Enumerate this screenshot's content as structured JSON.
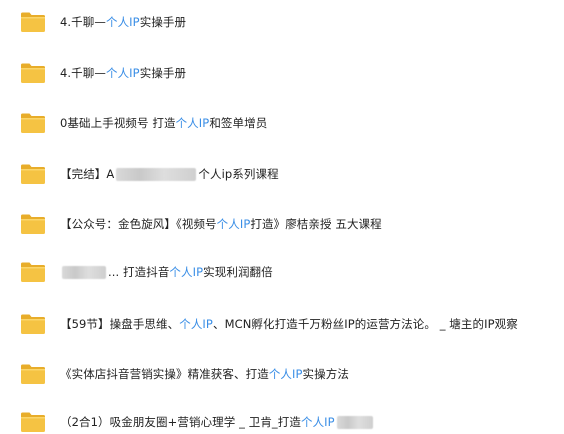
{
  "items": [
    {
      "parts": [
        {
          "t": "4.千聊—",
          "h": false
        },
        {
          "t": "个人IP",
          "h": true
        },
        {
          "t": "实操手册",
          "h": false
        }
      ]
    },
    {
      "parts": [
        {
          "t": "4.千聊—",
          "h": false
        },
        {
          "t": "个人IP",
          "h": true
        },
        {
          "t": "实操手册",
          "h": false
        }
      ]
    },
    {
      "parts": [
        {
          "t": "0基础上手视频号 打造",
          "h": false
        },
        {
          "t": "个人IP",
          "h": true
        },
        {
          "t": "和签单增员",
          "h": false
        }
      ]
    },
    {
      "parts": [
        {
          "t": "【完结】A",
          "h": false
        },
        {
          "blur": 80
        },
        {
          "t": "个人ip系列课程",
          "h": false
        }
      ]
    },
    {
      "parts": [
        {
          "t": "【公众号：金色旋风】《视频号",
          "h": false
        },
        {
          "t": "个人IP",
          "h": true
        },
        {
          "t": "打造》廖桔亲授 五大课程",
          "h": false
        }
      ]
    },
    {
      "parts": [
        {
          "blur": 44
        },
        {
          "t": "...  打造抖音",
          "h": false
        },
        {
          "t": "个人IP",
          "h": true
        },
        {
          "t": "实现利润翻倍",
          "h": false
        }
      ]
    },
    {
      "parts": [
        {
          "t": "【59节】操盘手思维、",
          "h": false
        },
        {
          "t": "个人IP",
          "h": true
        },
        {
          "t": "、MCN孵化打造千万粉丝IP的运营方法论。 _ 塘主的IP观察",
          "h": false
        }
      ]
    },
    {
      "parts": [
        {
          "t": "《实体店抖音营销实操》精准获客、打造",
          "h": false
        },
        {
          "t": "个人IP",
          "h": true
        },
        {
          "t": "实操方法",
          "h": false
        }
      ]
    },
    {
      "parts": [
        {
          "t": "（2合1）吸金朋友圈+营销心理学 _ 卫肯_打造",
          "h": false
        },
        {
          "t": "个人IP",
          "h": true
        },
        {
          "blur": 36
        }
      ]
    }
  ],
  "colors": {
    "highlight": "#3a8ee6",
    "folder_body": "#f5c343",
    "folder_tab": "#e8ad2a"
  },
  "icon": "folder-icon"
}
